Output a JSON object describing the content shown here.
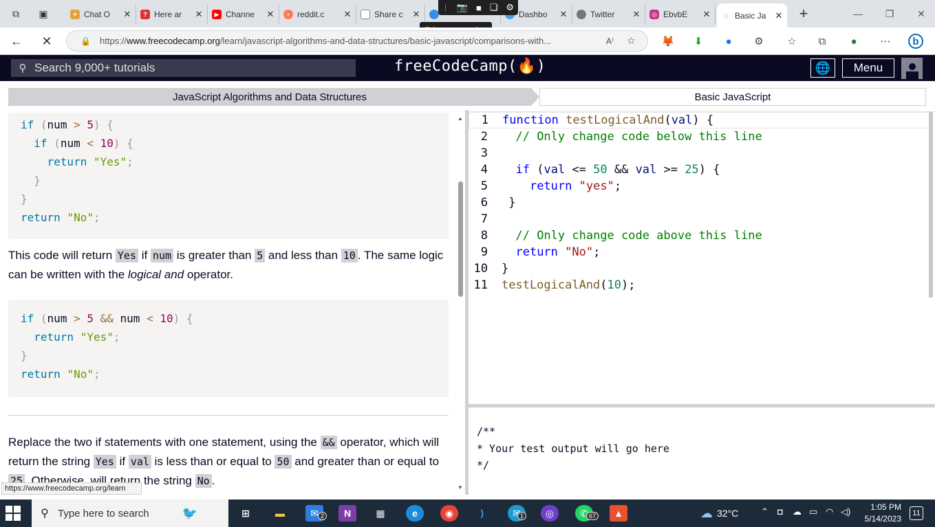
{
  "browser": {
    "tabs": [
      {
        "label": "Chat O",
        "icon": "chatgpt-icon",
        "color": "#e8a03a"
      },
      {
        "label": "Here ar",
        "icon": "help-icon",
        "color": "#d33"
      },
      {
        "label": "Channe",
        "icon": "youtube-icon",
        "color": "#f00"
      },
      {
        "label": "reddit.c",
        "icon": "reddit-icon",
        "color": "#ff7a4d"
      },
      {
        "label": "Share c",
        "icon": "page-icon",
        "color": "#888"
      },
      {
        "label": "",
        "icon": "edge-icon",
        "color": "#3a8ee6"
      },
      {
        "label": "Dashbo",
        "icon": "dashboard-icon",
        "color": "#4aa3df"
      },
      {
        "label": "Twitter",
        "icon": "twitter-icon",
        "color": "#777"
      },
      {
        "label": "EbvbE",
        "icon": "instagram-icon",
        "color": "#c13584"
      },
      {
        "label": "Basic Ja",
        "icon": "loading-icon",
        "color": "#0a7bd6"
      }
    ],
    "screenshot_tooltip": "Take a screenshot",
    "url_prefix": "https://",
    "url_domain": "www.freecodecamp.org",
    "url_path": "/learn/javascript-algorithms-and-data-structures/basic-javascript/comparisons-with...",
    "status_url": "https://www.freecodecamp.org/learn"
  },
  "fcc": {
    "search_placeholder": "Search 9,000+ tutorials",
    "logo": "freeCodeCamp(🔥)",
    "menu": "Menu"
  },
  "breadcrumb": {
    "left": "JavaScript Algorithms and Data Structures",
    "right": "Basic JavaScript"
  },
  "lesson": {
    "p1": {
      "t1": "This code will return ",
      "c1": "Yes",
      "t2": " if ",
      "c2": "num",
      "t3": " is greater than ",
      "c3": "5",
      "t4": " and less than ",
      "c4": "10",
      "t5": ". The same logic can be written with the ",
      "em": "logical and",
      "t6": " operator."
    },
    "p2": {
      "t1": "Replace the two if statements with one statement, using the ",
      "c1": "&&",
      "t2": " operator, which will return the string ",
      "c2": "Yes",
      "t3": " if ",
      "c3": "val",
      "t4": " is less than or equal to ",
      "c4": "50",
      "t5": " and greater than or equal to ",
      "c5": "25",
      "t6": ". Otherwise, will return the string ",
      "c6": "No",
      "t7": "."
    }
  },
  "editor": {
    "line_numbers": [
      "1",
      "2",
      "3",
      "4",
      "5",
      "6",
      "7",
      "8",
      "9",
      "10",
      "11"
    ]
  },
  "output": {
    "lines": [
      "/**",
      "* Your test output will go here",
      "*/"
    ]
  },
  "taskbar": {
    "search_placeholder": "Type here to search",
    "temperature": "32°C",
    "time": "1:05 PM",
    "date": "5/14/2023",
    "notifications": "11",
    "mail_badge": "2",
    "teams_badge": "1",
    "whatsapp_badge": "67"
  }
}
